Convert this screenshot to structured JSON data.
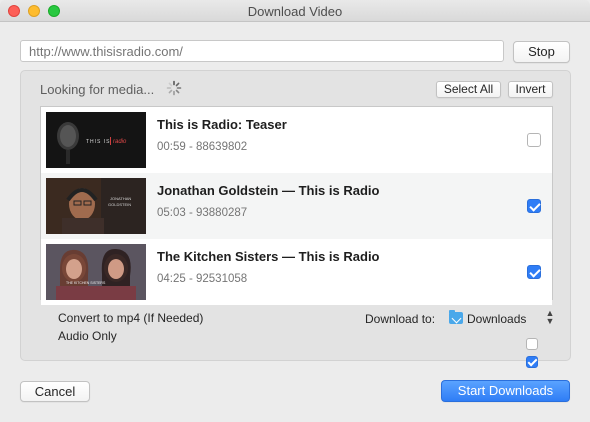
{
  "window": {
    "title": "Download Video"
  },
  "url_bar": {
    "value": "http://www.thisisradio.com/",
    "stop_label": "Stop"
  },
  "list_panel": {
    "status": "Looking for media...",
    "select_all_label": "Select All",
    "invert_label": "Invert",
    "items": [
      {
        "title": "This is Radio: Teaser",
        "meta": "00:59 - 88639802",
        "checked": false,
        "thumb_text": "THIS IS radio"
      },
      {
        "title": "Jonathan Goldstein — This is Radio",
        "meta": "05:03 - 93880287",
        "checked": true,
        "thumb_text": "JONATHAN GOLDSTEIN"
      },
      {
        "title": "The Kitchen Sisters — This is Radio",
        "meta": "04:25 - 92531058",
        "checked": true,
        "thumb_text": "THE KITCHEN SISTERS"
      }
    ]
  },
  "options": {
    "convert_label": "Convert to mp4 (If Needed)",
    "convert_checked": false,
    "audio_label": "Audio Only",
    "audio_checked": true,
    "download_to_label": "Download to:",
    "download_folder": "Downloads"
  },
  "footer": {
    "cancel_label": "Cancel",
    "start_label": "Start Downloads"
  },
  "colors": {
    "accent": "#2f7df6",
    "window_bg": "#ececec",
    "panel_bg": "#e3e3e3"
  }
}
